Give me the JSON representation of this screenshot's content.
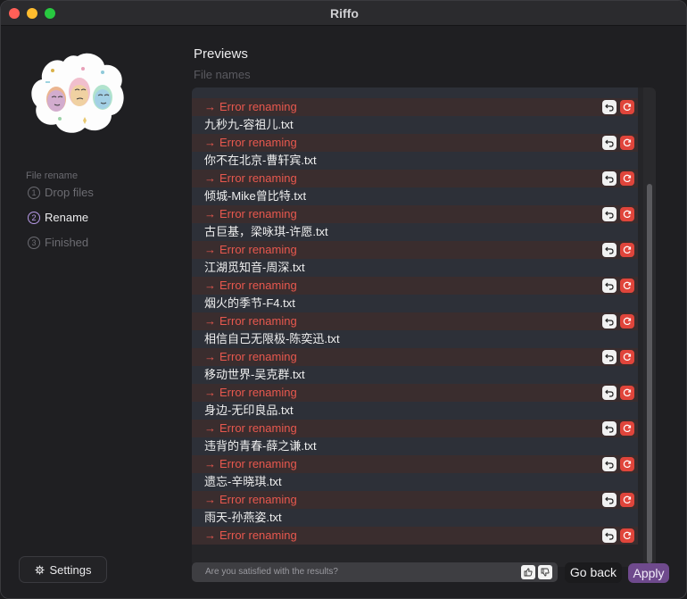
{
  "window": {
    "title": "Riffo"
  },
  "sidebar": {
    "section_title": "File rename",
    "steps": [
      {
        "num": "1",
        "label": "Drop files",
        "active": false
      },
      {
        "num": "2",
        "label": "Rename",
        "active": true
      },
      {
        "num": "3",
        "label": "Finished",
        "active": false
      }
    ],
    "settings_label": "Settings",
    "settings_icon": "gear-icon"
  },
  "main": {
    "title": "Previews",
    "subtitle": "File names",
    "error_text": "Error renaming",
    "arrow": "→",
    "files": [
      "九秒九-容祖儿.txt",
      "你不在北京-曹轩宾.txt",
      "倾城-Mike曾比特.txt",
      "古巨基，梁咏琪-许愿.txt",
      "江湖觅知音-周深.txt",
      "烟火的季节-F4.txt",
      "相信自己无限极-陈奕迅.txt",
      "移动世界-吴克群.txt",
      "身边-无印良品.txt",
      "违背的青春-薛之谦.txt",
      "遗忘-辛晓琪.txt",
      "雨天-孙燕姿.txt"
    ]
  },
  "footer": {
    "feedback_placeholder": "Are you satisfied with the results?",
    "go_back_label": "Go back",
    "apply_label": "Apply"
  },
  "colors": {
    "accent": "#6f4a8d",
    "error": "#e8584e",
    "retry": "#e0453b"
  }
}
